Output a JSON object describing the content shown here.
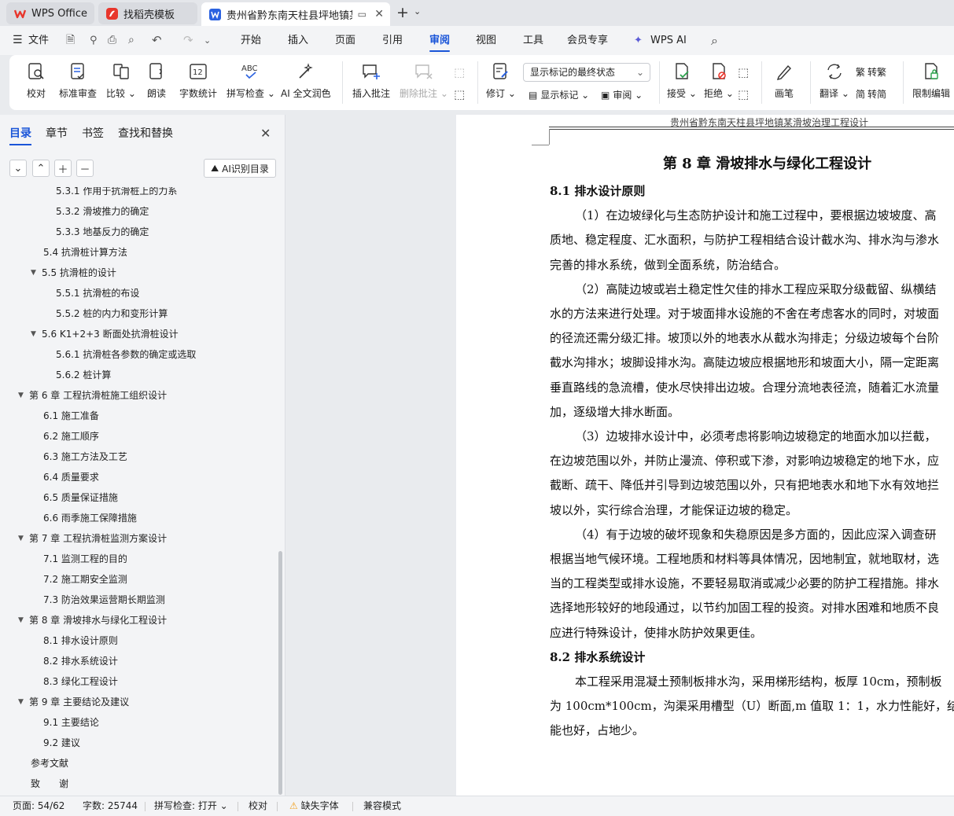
{
  "tabs": [
    {
      "label": "WPS Office"
    },
    {
      "label": "找稻壳模板"
    },
    {
      "label": "贵州省黔东南天柱县坪地镇某"
    }
  ],
  "menu": {
    "file": "文件",
    "items": [
      "开始",
      "插入",
      "页面",
      "引用",
      "审阅",
      "视图",
      "工具",
      "会员专享",
      "WPS AI"
    ]
  },
  "ribbon": {
    "buttons": [
      "校对",
      "标准审查",
      "比较",
      "朗读",
      "字数统计",
      "拼写检查",
      "AI 全文润色",
      "插入批注",
      "删除批注",
      "修订",
      "接受",
      "拒绝",
      "画笔",
      "翻译",
      "限制编辑"
    ],
    "markup_select": "显示标记的最终状态",
    "show_markup": "显示标记",
    "review_pane": "审阅",
    "to_traditional": "转繁",
    "to_simplified": "转简"
  },
  "panel": {
    "tabs": [
      "目录",
      "章节",
      "书签",
      "查找和替换"
    ],
    "ai_button": "AI识别目录",
    "toc": [
      "5.3.1 作用于抗滑桩上的力系",
      "5.3.2 滑坡推力的确定",
      "5.3.3 地基反力的确定",
      "5.4 抗滑桩计算方法",
      "5.5 抗滑桩的设计",
      "5.5.1 抗滑桩的布设",
      "5.5.2 桩的内力和变形计算",
      "5.6 K1+2+3 断面处抗滑桩设计",
      "5.6.1 抗滑桩各参数的确定或选取",
      "5.6.2 桩计算",
      "第 6 章 工程抗滑桩施工组织设计",
      "6.1 施工准备",
      "6.2 施工顺序",
      "6.3 施工方法及工艺",
      "6.4 质量要求",
      "6.5 质量保证措施",
      "6.6 雨季施工保障措施",
      "第 7 章 工程抗滑桩监测方案设计",
      "7.1 监测工程的目的",
      "7.2 施工期安全监测",
      "7.3 防治效果运营期长期监测",
      "第 8 章 滑坡排水与绿化工程设计",
      "8.1 排水设计原则",
      "8.2 排水系统设计",
      "8.3 绿化工程设计",
      "第 9 章 主要结论及建议",
      "9.1 主要结论",
      "9.2 建议",
      "参考文献",
      "致　　谢"
    ]
  },
  "doc": {
    "header": "贵州省黔东南天柱县坪地镇某滑坡治理工程设计",
    "chapter": "第 8 章  滑坡排水与绿化工程设计",
    "s1": "8.1  排水设计原则",
    "p1": [
      "（1）在边坡绿化与生态防护设计和施工过程中，要根据边坡坡度、高",
      "质地、稳定程度、汇水面积，与防护工程相结合设计截水沟、排水沟与渗水",
      "完善的排水系统，做到全面系统，防治结合。"
    ],
    "p2": [
      "（2）高陡边坡或岩土稳定性欠佳的排水工程应采取分级截留、纵横结",
      "水的方法来进行处理。对于坡面排水设施的不舍在考虑客水的同时，对坡面",
      "的径流还需分级汇排。坡顶以外的地表水从截水沟排走；分级边坡每个台阶",
      "截水沟排水；坡脚设排水沟。高陡边坡应根据地形和坡面大小，隔一定距离",
      "垂直路线的急流槽，使水尽快排出边坡。合理分流地表径流，随着汇水流量",
      "加，逐级增大排水断面。"
    ],
    "p3": [
      "（3）边坡排水设计中，必须考虑将影响边坡稳定的地面水加以拦截，",
      "在边坡范围以外，并防止漫流、停积或下渗，对影响边坡稳定的地下水，应",
      "截断、疏干、降低并引导到边坡范围以外，只有把地表水和地下水有效地拦",
      "坡以外，实行综合治理，才能保证边坡的稳定。"
    ],
    "p4": [
      "（4）有于边坡的破坏现象和失稳原因是多方面的，因此应深入调查研",
      "根据当地气候环境。工程地质和材料等具体情况，因地制宜，就地取材，选",
      "当的工程类型或排水设施，不要轻易取消或减少必要的防护工程措施。排水",
      "选择地形较好的地段通过，以节约加固工程的投资。对排水困难和地质不良",
      "应进行特殊设计，使排水防护效果更佳。"
    ],
    "s2": "8.2  排水系统设计",
    "p5": [
      "本工程采用混凝土预制板排水沟，采用梯形结构，板厚 10cm，预制板",
      "为 100cm*100cm，沟渠采用槽型（U）断面,m 值取 1：1，水力性能好，结",
      "能也好，占地少。"
    ]
  },
  "status": {
    "page": "页面: 54/62",
    "words": "字数: 25744",
    "spell": "拼写检查: 打开",
    "proof": "校对",
    "missing_font": "缺失字体",
    "compat": "兼容模式"
  },
  "colors": {
    "accent": "#1a55d8",
    "wps_red": "#e8362c",
    "word_blue": "#2b62e0"
  }
}
